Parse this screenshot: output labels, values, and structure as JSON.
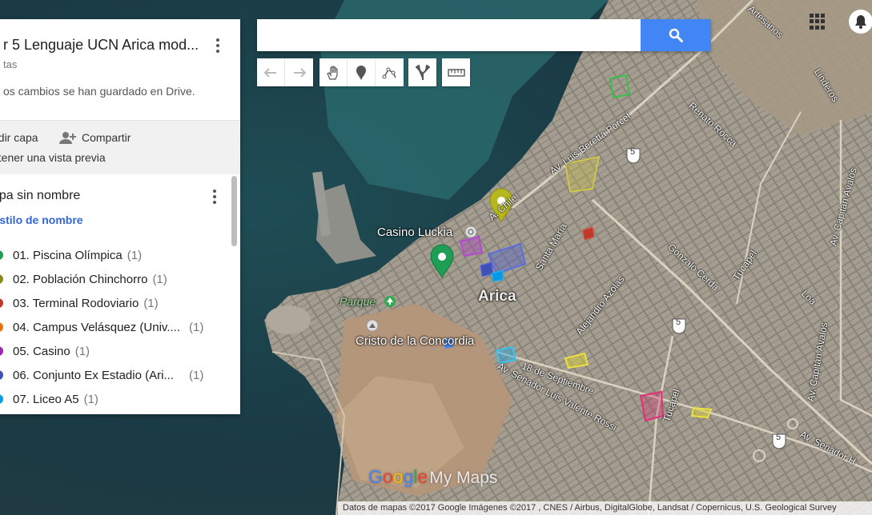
{
  "map": {
    "city_label": "Arica",
    "places": [
      {
        "label": "Casino Luckia",
        "icon": "casino-icon"
      },
      {
        "label": "Parque",
        "icon": "park-icon"
      },
      {
        "label": "Cristo de la Concordia",
        "icon": "monument-icon"
      }
    ],
    "roads": [
      "Av. Luis Beretta Porcel",
      "Renato Rocca",
      "Linderos",
      "Av. Capitán Ávalos",
      "Av. Capitán Ávalos",
      "Gonzalo Cerda",
      "Tucapel",
      "Tucapel",
      "Loa",
      "Santa María",
      "Alejandro Azolas",
      "18 de Septiembre",
      "Av. Senador Luis Valente Rossi",
      "Av. Senador H",
      "Artesanos",
      "A. Chile"
    ],
    "route_shields": [
      "5",
      "5",
      "5"
    ],
    "marker_colors": {
      "green": "#1e9e55",
      "olive": "#b5b81f"
    }
  },
  "panel": {
    "title": "r 5 Lenguaje UCN Arica mod...",
    "subtitle": "tas",
    "saved_status": "os cambios se han guardado en Drive.",
    "add_layer": "adir capa",
    "share": "Compartir",
    "preview": "btener una vista previa",
    "layer": {
      "name": "apa sin nombre",
      "style_link": "Estilo de nombre",
      "items": [
        {
          "label": "01. Piscina Olímpica",
          "count": "(1)",
          "color": "#1e9e55"
        },
        {
          "label": "02. Población Chinchorro",
          "count": "(1)",
          "color": "#8a8a1a"
        },
        {
          "label": "03. Terminal Rodoviario",
          "count": "(1)",
          "color": "#c0392b"
        },
        {
          "label": "04. Campus Velásquez (Univ....",
          "count": "(1)",
          "color": "#e8710a"
        },
        {
          "label": "05. Casino",
          "count": "(1)",
          "color": "#9c27b0"
        },
        {
          "label": "06. Conjunto Ex Estadio (Ari...",
          "count": "(1)",
          "color": "#3f51b5"
        },
        {
          "label": "07. Liceo A5",
          "count": "(1)",
          "color": "#039be5"
        }
      ]
    }
  },
  "search": {
    "placeholder": "",
    "button_icon": "search-icon"
  },
  "toolbar": {
    "icons": [
      "undo-icon",
      "redo-icon",
      "hand-icon",
      "marker-icon",
      "draw-line-icon",
      "directions-icon",
      "ruler-icon"
    ]
  },
  "footer": {
    "logo_google": [
      "G",
      "o",
      "o",
      "g",
      "l",
      "e"
    ],
    "logo_product": "My Maps",
    "attribution": "Datos de mapas ©2017 Google Imágenes ©2017 , CNES / Airbus, DigitalGlobe, Landsat / Copernicus, U.S. Geological Survey"
  }
}
